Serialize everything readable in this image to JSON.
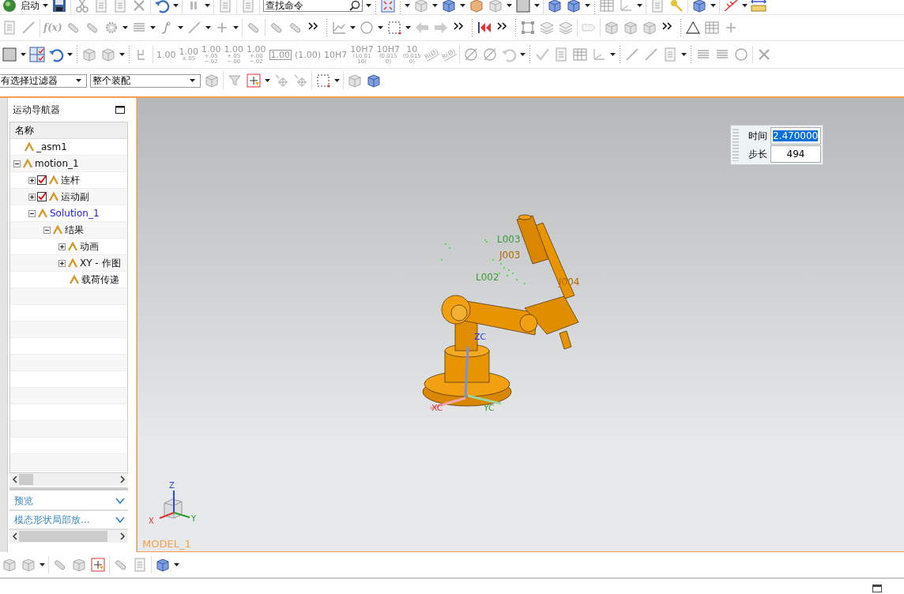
{
  "toolbar": {
    "start_button": "启动",
    "search_field": {
      "placeholder": "查找命令"
    },
    "formula_button": "f(x)",
    "dimension_buttons": [
      {
        "lines": [
          "1.00"
        ],
        "boxed": false
      },
      {
        "lines": [
          "1.00",
          "±.05"
        ],
        "boxed": false
      },
      {
        "lines": [
          "1.00",
          "+.05",
          "−.02"
        ],
        "boxed": false
      },
      {
        "lines": [
          "1.00",
          "+.05",
          "−.00"
        ],
        "boxed": false
      },
      {
        "lines": [
          "1.00",
          "+.00",
          "−.02"
        ],
        "boxed": false
      },
      {
        "lines": [
          "1.00"
        ],
        "boxed": true
      },
      {
        "lines": [
          "(1.00)"
        ],
        "boxed": false
      },
      {
        "lines": [
          "10H7"
        ],
        "boxed": false
      },
      {
        "lines": [
          "10H7",
          "(10.01",
          "10)"
        ],
        "boxed": false
      },
      {
        "lines": [
          "10H7",
          "(0.015",
          "0)"
        ],
        "boxed": false
      },
      {
        "lines": [
          "10",
          "(0.015",
          "0)"
        ],
        "boxed": false
      }
    ],
    "radius_buttons": [
      "R(Ø)",
      "R(Ø)"
    ],
    "filter_dropdowns": [
      "有选择过滤器",
      "整个装配"
    ]
  },
  "navigator": {
    "title": "运动导航器",
    "column": "名称",
    "tree": [
      {
        "label": "_asm1",
        "active": false
      },
      {
        "label": "motion_1",
        "expanded": true,
        "active": false,
        "children": [
          {
            "label": "连杆",
            "expanded": false,
            "checked": true,
            "active": false
          },
          {
            "label": "运动副",
            "expanded": false,
            "checked": true,
            "active": false
          },
          {
            "label": "Solution_1",
            "expanded": true,
            "active": true,
            "children": [
              {
                "label": "结果",
                "expanded": true,
                "active": false,
                "children": [
                  {
                    "label": "动画",
                    "expanded": false,
                    "active": false
                  },
                  {
                    "label": "XY - 作图",
                    "expanded": false,
                    "active": false
                  },
                  {
                    "label": "载荷传递",
                    "active": false
                  }
                ]
              }
            ]
          }
        ]
      }
    ],
    "panels": [
      {
        "title": "预览",
        "expanded": false
      },
      {
        "title": "模态形状局部放...",
        "expanded": false
      }
    ]
  },
  "viewport": {
    "time_label": "时间",
    "time_value": "2.470000",
    "time_selected": true,
    "step_label": "步长",
    "step_value": "494",
    "model_labels": [
      {
        "text": "L003",
        "kind": "link"
      },
      {
        "text": "J003",
        "kind": "joint"
      },
      {
        "text": "L002",
        "kind": "link"
      },
      {
        "text": "J004",
        "kind": "joint"
      }
    ],
    "axis_labels": {
      "zc": "ZC",
      "xc": "XC",
      "yc": "YC"
    },
    "triad_labels": {
      "x": "X",
      "y": "Y",
      "z": "Z"
    },
    "view_name": "MODEL_1"
  }
}
